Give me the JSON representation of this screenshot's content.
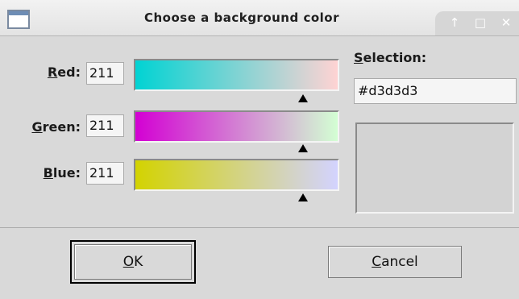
{
  "window": {
    "title": "Choose a background color",
    "buttons": [
      {
        "name": "raise-icon",
        "glyph": "↑"
      },
      {
        "name": "maximize-icon",
        "glyph": "□"
      },
      {
        "name": "close-icon",
        "glyph": "✕"
      }
    ]
  },
  "channels": [
    {
      "key": "R",
      "label_rest": "ed:",
      "value": "211",
      "gradient_from": "#00d3d3",
      "gradient_to": "#ffd3d3",
      "level": 0.827
    },
    {
      "key": "G",
      "label_rest": "reen:",
      "value": "211",
      "gradient_from": "#d300d3",
      "gradient_to": "#d3ffd3",
      "level": 0.827
    },
    {
      "key": "B",
      "label_rest": "lue:",
      "value": "211",
      "gradient_from": "#d3d300",
      "gradient_to": "#d3d3ff",
      "level": 0.827
    }
  ],
  "selection": {
    "label_key": "S",
    "label_rest": "election:",
    "value": "#d3d3d3",
    "swatch_color": "#d3d3d3"
  },
  "buttons": {
    "ok": {
      "key": "O",
      "rest": "K"
    },
    "cancel": {
      "key": "C",
      "rest": "ancel"
    }
  }
}
